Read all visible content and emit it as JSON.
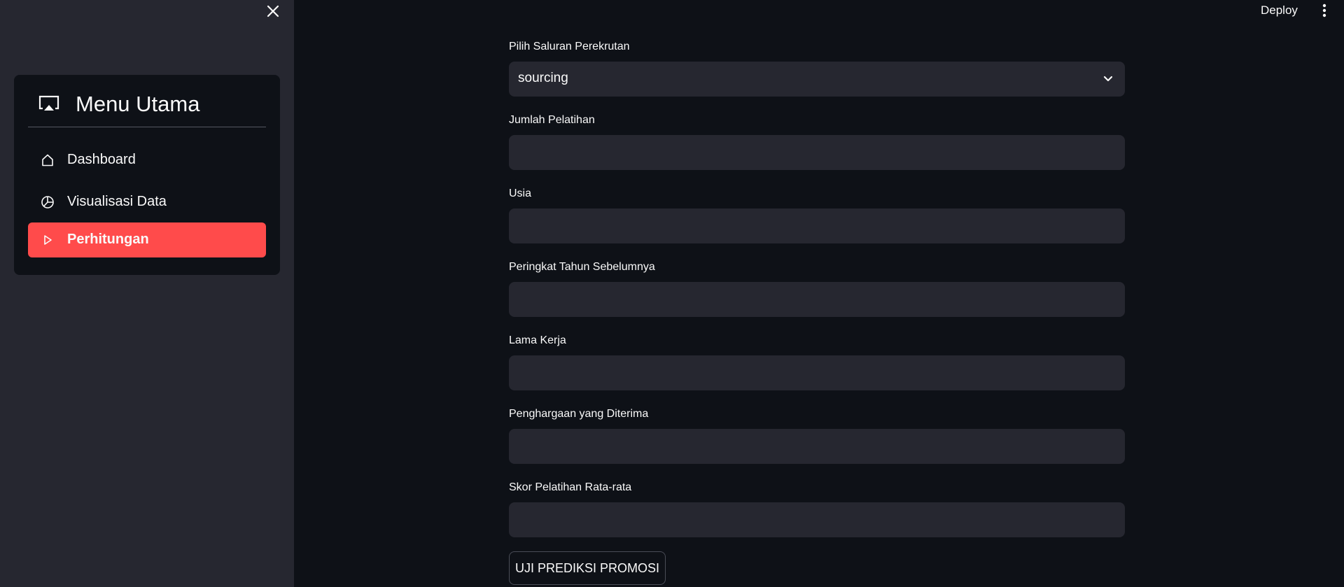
{
  "header": {
    "deploy_label": "Deploy",
    "menu_icon": "kebab-menu-icon"
  },
  "sidebar": {
    "close_icon": "close-icon",
    "menu": {
      "title": "Menu Utama",
      "title_icon": "cast-screen-icon",
      "items": [
        {
          "label": "Dashboard",
          "icon": "home-icon",
          "active": false
        },
        {
          "label": "Visualisasi Data",
          "icon": "pie-chart-icon",
          "active": false
        },
        {
          "label": "Perhitungan",
          "icon": "play-icon",
          "active": true
        }
      ]
    }
  },
  "form": {
    "channel": {
      "label": "Pilih Saluran Perekrutan",
      "value": "sourcing"
    },
    "trainings": {
      "label": "Jumlah Pelatihan",
      "value": ""
    },
    "age": {
      "label": "Usia",
      "value": ""
    },
    "prev_rating": {
      "label": "Peringkat Tahun Sebelumnya",
      "value": ""
    },
    "tenure": {
      "label": "Lama Kerja",
      "value": ""
    },
    "awards": {
      "label": "Penghargaan yang Diterima",
      "value": ""
    },
    "avg_score": {
      "label": "Skor Pelatihan Rata-rata",
      "value": ""
    },
    "submit_label": "UJI PREDIKSI PROMOSI"
  },
  "colors": {
    "background": "#0e1117",
    "sidebar": "#262730",
    "input": "#262730",
    "accent": "#ff4b4b",
    "text": "#fafafa"
  }
}
